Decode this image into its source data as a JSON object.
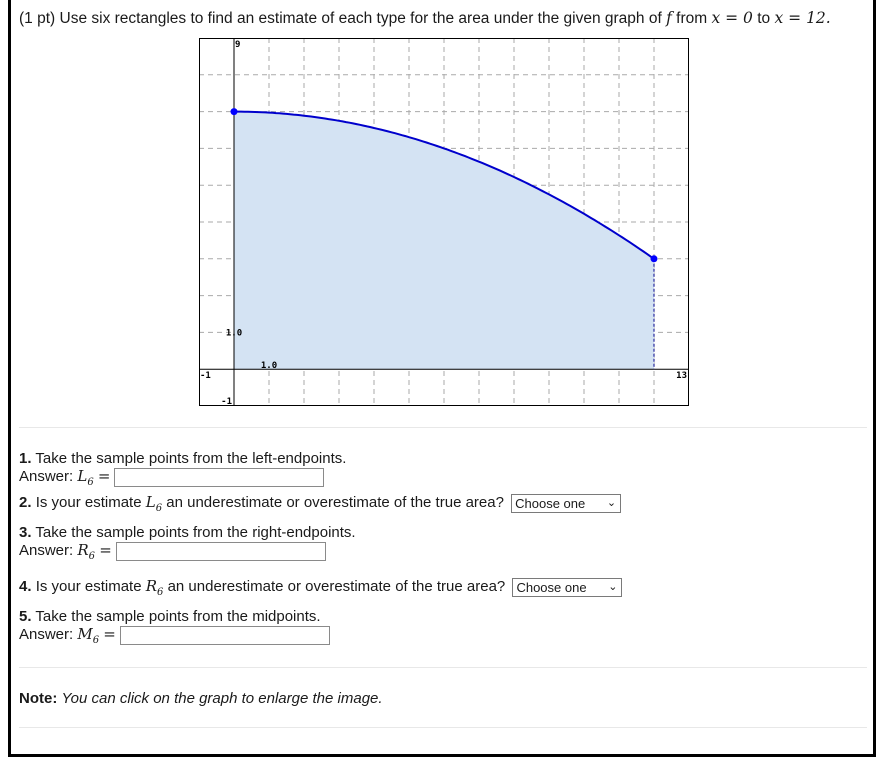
{
  "problem": {
    "points": "(1 pt)",
    "prompt_a": "Use six rectangles to find an estimate of each type for the area under the given graph of",
    "f": "f",
    "from": "from",
    "x_eq_0": "x = 0",
    "to": "to",
    "x_eq_12": "x = 12."
  },
  "chart_data": {
    "type": "area",
    "title": "",
    "function_description": "decreasing concave-down curve, approx f(x) = 7 - x^2/36",
    "points": [
      [
        0,
        7
      ],
      [
        1,
        6.97
      ],
      [
        2,
        6.89
      ],
      [
        3,
        6.75
      ],
      [
        4,
        6.56
      ],
      [
        5,
        6.31
      ],
      [
        6,
        6.0
      ],
      [
        7,
        5.64
      ],
      [
        8,
        5.22
      ],
      [
        9,
        4.75
      ],
      [
        10,
        4.22
      ],
      [
        11,
        3.64
      ],
      [
        12,
        3.0
      ]
    ],
    "endpoints": [
      [
        0,
        7
      ],
      [
        12,
        3
      ]
    ],
    "xlim": [
      -1,
      13
    ],
    "ylim": [
      -1,
      9
    ],
    "grid": true,
    "x_tick_labels": [
      "-1",
      "1.0",
      "13"
    ],
    "y_tick_labels": [
      "-1",
      "1.0",
      "9"
    ],
    "shade_color": "#d4e3f3",
    "curve_color": "#0000cc"
  },
  "questions": [
    {
      "num": "1.",
      "text": "Take the sample points from the left-endpoints.",
      "answer_label": "Answer:",
      "var": "L",
      "sub": "6",
      "value": ""
    },
    {
      "num": "2.",
      "text_a": "Is your estimate",
      "var": "L",
      "sub": "6",
      "text_b": "an underestimate or overestimate of the true area?",
      "select": "Choose one"
    },
    {
      "num": "3.",
      "text": "Take the sample points from the right-endpoints.",
      "answer_label": "Answer:",
      "var": "R",
      "sub": "6",
      "value": ""
    },
    {
      "num": "4.",
      "text_a": "Is your estimate",
      "var": "R",
      "sub": "6",
      "text_b": "an underestimate or overestimate of the true area?",
      "select": "Choose one"
    },
    {
      "num": "5.",
      "text": "Take the sample points from the midpoints.",
      "answer_label": "Answer:",
      "var": "M",
      "sub": "6",
      "value": ""
    }
  ],
  "note": {
    "label": "Note:",
    "text": "You can click on the graph to enlarge the image."
  },
  "select_chevron": "❯"
}
